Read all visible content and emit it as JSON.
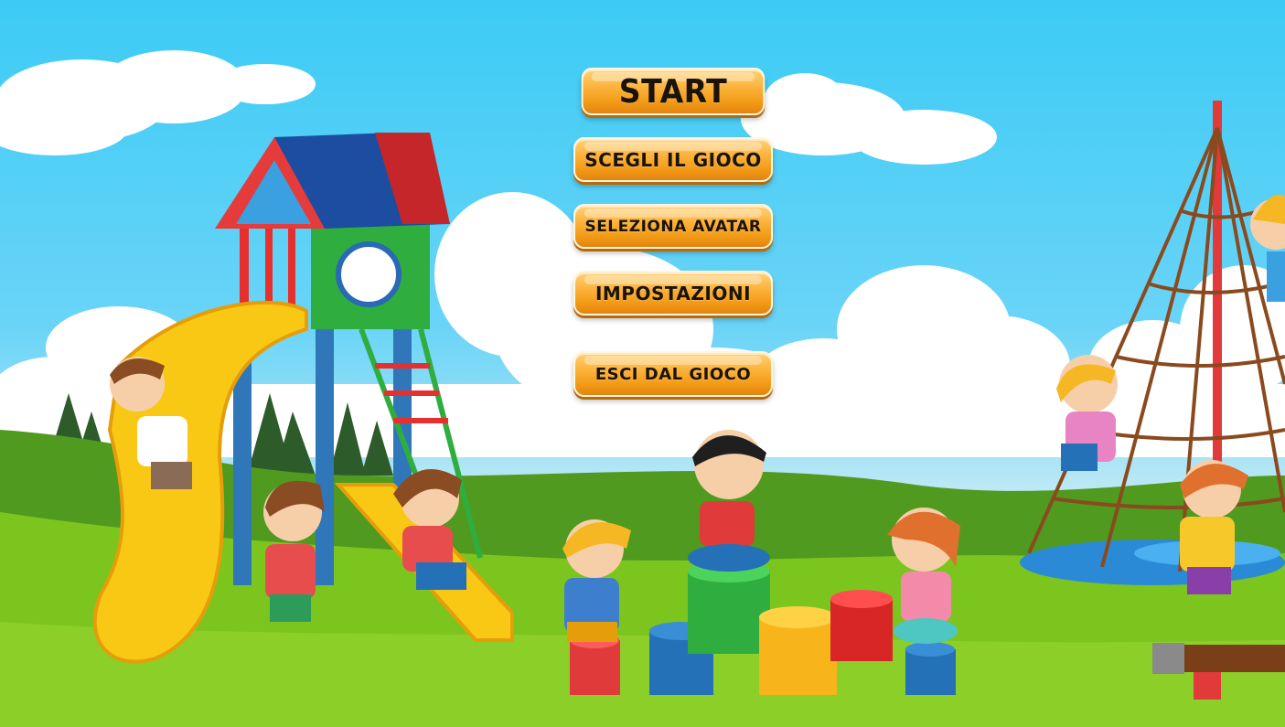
{
  "menu": {
    "start_label": "START",
    "choose_game_label": "SCEGLI IL GIOCO",
    "select_avatar_label": "SELEZIONA AVATAR",
    "settings_label": "IMPOSTAZIONI",
    "exit_label": "ESCI DAL GIOCO"
  },
  "colors": {
    "sky": "#3ccbf5",
    "grass": "#7cc51e",
    "button_orange": "#f6a623",
    "button_text": "#1b1208"
  }
}
